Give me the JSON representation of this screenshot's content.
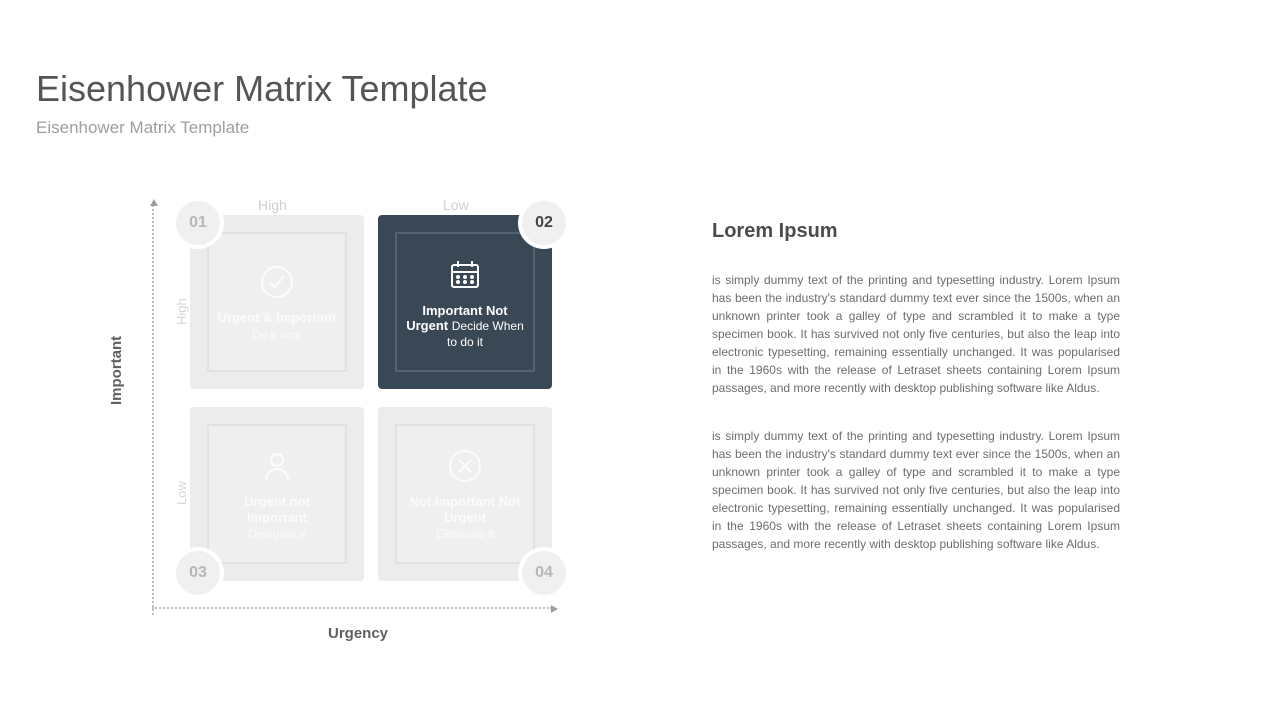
{
  "heading": {
    "title": "Eisenhower Matrix Template",
    "subtitle": "Eisenhower Matrix Template"
  },
  "axes": {
    "y": "Important",
    "x": "Urgency",
    "col_high": "High",
    "col_low": "Low",
    "row_high": "High",
    "row_low": "Low"
  },
  "quadrants": {
    "q1": {
      "num": "01",
      "title": "Urgent & Important",
      "sub": "Do it now"
    },
    "q2": {
      "num": "02",
      "title": "Important Not Urgent",
      "sub": "Decide When to do it"
    },
    "q3": {
      "num": "03",
      "title": "Urgent not Important",
      "sub": "Delegate it"
    },
    "q4": {
      "num": "04",
      "title": "Not Important Not Urgent",
      "sub": "Eliminate it"
    }
  },
  "detail": {
    "title": "Lorem Ipsum",
    "p1": "is simply dummy text of the printing and typesetting industry. Lorem Ipsum has been the industry's standard dummy text ever since the 1500s, when an unknown printer took a galley of type and scrambled it to make a type specimen book. It has survived not only five centuries, but also the leap into electronic typesetting, remaining essentially unchanged. It was popularised in the 1960s with the release of Letraset sheets containing Lorem Ipsum passages, and more recently with desktop publishing software like Aldus.",
    "p2": "is simply dummy text of the printing and typesetting industry. Lorem Ipsum has been the industry's standard dummy text ever since the 1500s, when an unknown printer took a galley of type and scrambled it to make a type specimen book. It has survived not only five centuries, but also the leap into electronic typesetting, remaining essentially unchanged. It was popularised in the 1960s with the release of Letraset sheets containing Lorem Ipsum passages, and more recently with desktop publishing software like Aldus."
  }
}
